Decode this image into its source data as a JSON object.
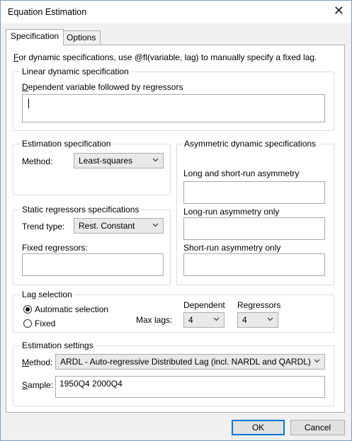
{
  "window": {
    "title": "Equation Estimation",
    "close_glyph": "✕"
  },
  "tabs": [
    {
      "label": "Specification",
      "active": true
    },
    {
      "label": "Options",
      "active": false
    }
  ],
  "specification": {
    "hint": {
      "before": "",
      "underline": "F",
      "after": "or dynamic specifications, use @fl(variable, lag) to manually specify a fixed lag."
    },
    "linear_dynamic": {
      "legend": "Linear dynamic specification",
      "dependent_label": {
        "underline": "D",
        "after": "ependent variable followed by regressors"
      },
      "dependent_value": ""
    },
    "estimation_spec": {
      "legend": "Estimation specification",
      "method_label": "Method:",
      "method_value": "Least-squares"
    },
    "asymmetric": {
      "legend": "Asymmetric dynamic specifications",
      "long_short_label": "Long and short-run asymmetry",
      "long_only_label": "Long-run asymmetry only",
      "short_only_label": "Short-run asymmetry only",
      "long_short_value": "",
      "long_only_value": "",
      "short_only_value": ""
    },
    "static": {
      "legend": "Static regressors specifications",
      "trend_label": "Trend type:",
      "trend_value": "Rest. Constant",
      "fixed_label": "Fixed regressors:",
      "fixed_value": ""
    },
    "lag_selection": {
      "legend": "Lag selection",
      "automatic_label": "Automatic selection",
      "fixed_label": "Fixed",
      "selected": "automatic",
      "max_lags_label": "Max lags:",
      "dependent_label": "Dependent",
      "regressors_label": "Regressors",
      "dependent_value": "4",
      "regressors_value": "4"
    },
    "estimation_settings": {
      "legend": "Estimation settings",
      "method_label": {
        "underline": "M",
        "after": "ethod:"
      },
      "method_value": "ARDL - Auto-regressive Distributed Lag (incl. NARDL and QARDL)",
      "sample_label": {
        "underline": "S",
        "after": "ample:"
      },
      "sample_value": "1950Q4 2000Q4"
    }
  },
  "footer": {
    "ok_label": "OK",
    "cancel_label": "Cancel"
  }
}
